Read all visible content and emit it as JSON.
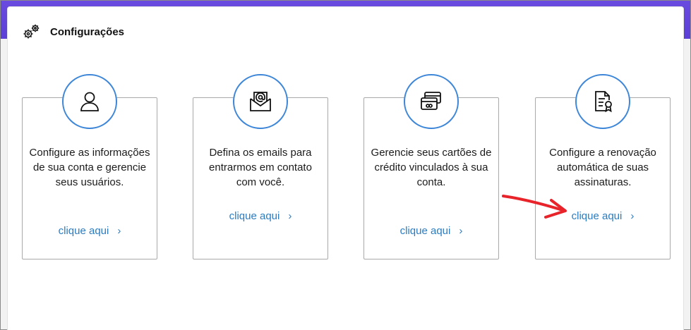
{
  "header": {
    "title": "Configurações",
    "icon": "gears-icon"
  },
  "cards": [
    {
      "icon": "user-icon",
      "text": "Configure as informações de sua conta e gerencie seus usuários.",
      "link": "clique aqui"
    },
    {
      "icon": "email-envelope-icon",
      "text": "Defina os emails para entrarmos em contato com você.",
      "link": "clique aqui"
    },
    {
      "icon": "credit-cards-icon",
      "text": "Gerencie seus cartões de crédito vinculados à sua conta.",
      "link": "clique aqui"
    },
    {
      "icon": "certificate-icon",
      "text": "Configure a renovação automática de suas assinaturas.",
      "link": "clique aqui"
    }
  ],
  "colors": {
    "accent": "#3d86d8",
    "link": "#2a7cc2",
    "topbar": "#5b3fd6",
    "annotation_arrow": "#e8232a"
  }
}
